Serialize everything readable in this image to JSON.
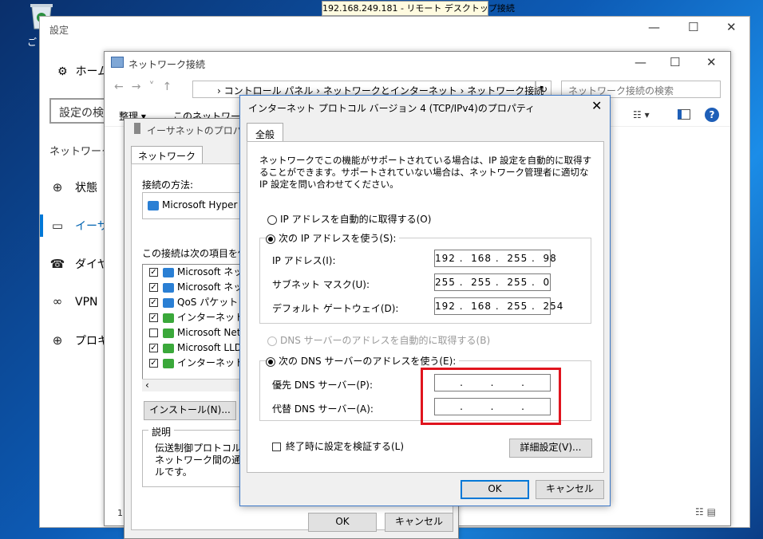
{
  "rdp_bar": "192.168.249.181 - リモート デスクトップ接続",
  "desktop": {
    "recycle_label": "ご"
  },
  "settings": {
    "title": "設定",
    "home": "ホーム",
    "search_placeholder": "設定の検",
    "category": "ネットワークと",
    "nav": [
      {
        "icon": "globe-icon",
        "label": "状態"
      },
      {
        "icon": "ethernet-icon",
        "label": "イーサネ"
      },
      {
        "icon": "dialup-icon",
        "label": "ダイヤ"
      },
      {
        "icon": "vpn-icon",
        "label": "VPN"
      },
      {
        "icon": "proxy-icon",
        "label": "プロキシ"
      }
    ]
  },
  "netconn": {
    "title": "ネットワーク接続",
    "address": "› コントロール パネル  ›  ネットワークとインターネット  ›  ネットワーク接続",
    "search_placeholder": "ネットワーク接続の検索",
    "toolbar_organize": "整理 ▾",
    "toolbar_item2": "このネットワーク デ",
    "status": "1",
    "help": "?"
  },
  "ethprop": {
    "title": "イーサネットのプロパティ",
    "tab": "ネットワーク",
    "connect_using_label": "接続の方法:",
    "adapter": "Microsoft Hyper",
    "items_label": "この接続は次の項目を使用",
    "items": [
      {
        "checked": true,
        "label": "Microsoft ネット"
      },
      {
        "checked": true,
        "label": "Microsoft ネット"
      },
      {
        "checked": true,
        "label": "QoS パケット スケ"
      },
      {
        "checked": true,
        "label": "インターネット プロ"
      },
      {
        "checked": false,
        "label": "Microsoft Netw"
      },
      {
        "checked": true,
        "label": "Microsoft LLDP"
      },
      {
        "checked": true,
        "label": "インターネット プロ"
      }
    ],
    "install_button": "インストール(N)...",
    "desc_label": "説明",
    "desc_lines": [
      "伝送制御プロトコル/イ",
      "ネットワーク間の通信を",
      "ルです。"
    ],
    "ok": "OK",
    "cancel": "キャンセル"
  },
  "ipv4": {
    "title": "インターネット プロトコル バージョン 4 (TCP/IPv4)のプロパティ",
    "tab": "全般",
    "intro": "ネットワークでこの機能がサポートされている場合は、IP 設定を自動的に取得することができます。サポートされていない場合は、ネットワーク管理者に適切な IP 設定を問い合わせてください。",
    "auto_ip": "IP アドレスを自動的に取得する(O)",
    "manual_ip": "次の IP アドレスを使う(S):",
    "ip_label": "IP アドレス(I):",
    "ip_value": "192 .  168 .  255 .  98",
    "mask_label": "サブネット マスク(U):",
    "mask_value": "255 .  255 .  255 .  0",
    "gw_label": "デフォルト ゲートウェイ(D):",
    "gw_value": "192 .  168 .  255 .  254",
    "auto_dns": "DNS サーバーのアドレスを自動的に取得する(B)",
    "manual_dns": "次の DNS サーバーのアドレスを使う(E):",
    "pref_dns_label": "優先 DNS サーバー(P):",
    "pref_dns_value": ".       .       .",
    "alt_dns_label": "代替 DNS サーバー(A):",
    "alt_dns_value": ".       .       .",
    "verify": "終了時に設定を検証する(L)",
    "advanced": "詳細設定(V)...",
    "ok": "OK",
    "cancel": "キャンセル",
    "close": "✕"
  },
  "window_controls": {
    "min": "—",
    "max": "☐",
    "close": "✕"
  },
  "colors": {
    "accent": "#0078d7",
    "highlight": "#e0141e"
  }
}
